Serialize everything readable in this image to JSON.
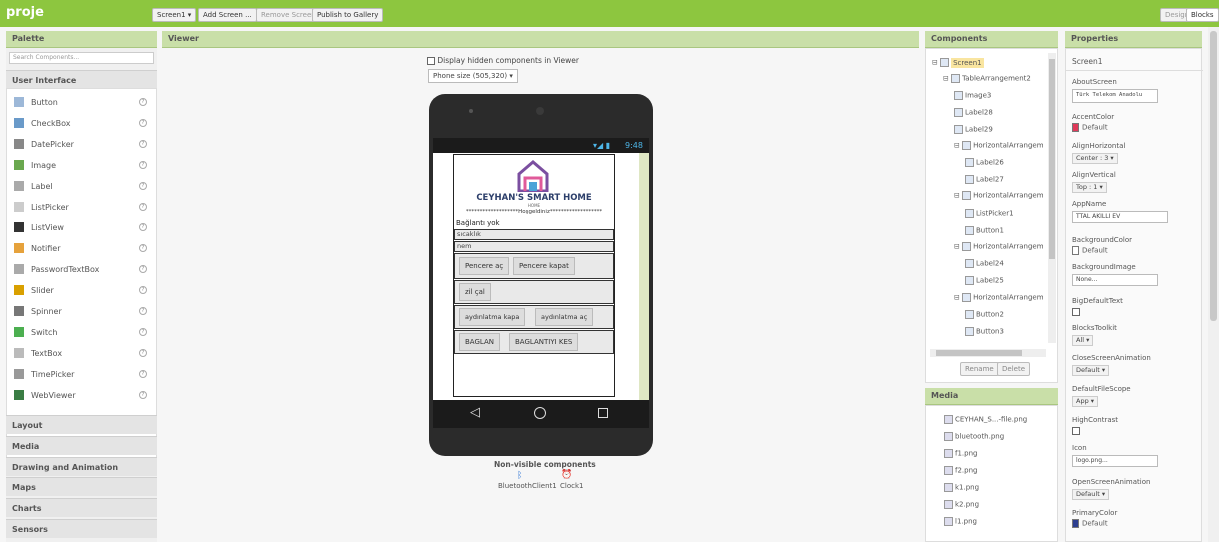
{
  "topbar": {
    "project": "proje",
    "screen_select": "Screen1 ▾",
    "add_screen": "Add Screen ...",
    "remove_screen": "Remove Screen",
    "publish": "Publish to Gallery",
    "designer": "Designer",
    "blocks": "Blocks"
  },
  "palette": {
    "title": "Palette",
    "search_placeholder": "Search Components...",
    "category_open": "User Interface",
    "items": [
      "Button",
      "CheckBox",
      "DatePicker",
      "Image",
      "Label",
      "ListPicker",
      "ListView",
      "Notifier",
      "PasswordTextBox",
      "Slider",
      "Spinner",
      "Switch",
      "TextBox",
      "TimePicker",
      "WebViewer"
    ],
    "categories": [
      "Layout",
      "Media",
      "Drawing and Animation",
      "Maps",
      "Charts",
      "Sensors"
    ],
    "help": "?"
  },
  "viewer": {
    "title": "Viewer",
    "hidden_label": "Display hidden components in Viewer",
    "phone_size": "Phone size (505,320)",
    "time": "9:48",
    "logo_title": "CEYHAN'S SMART HOME",
    "logo_sub": "HOME",
    "welcome": "*******************Hoşgeldiniz*******************",
    "status": "Bağlantı yok",
    "temp": "sıcaklık",
    "humidity": "nem",
    "btn_window_open": "Pencere aç",
    "btn_window_close": "Pencere kapat",
    "btn_bell": "zil çal",
    "btn_light_off": "aydınlatma kapa",
    "btn_light_on": "aydınlatma aç",
    "btn_connect": "BAGLAN",
    "btn_disconnect": "BAGLANTIYI KES",
    "nonvisible_title": "Non-visible components",
    "nonvisible": [
      "BluetoothClient1",
      "Clock1"
    ]
  },
  "components": {
    "title": "Components",
    "tree": [
      "Screen1",
      "TableArrangement2",
      "Image3",
      "Label28",
      "Label29",
      "HorizontalArrangem",
      "Label26",
      "Label27",
      "HorizontalArrangem",
      "ListPicker1",
      "Button1",
      "HorizontalArrangem",
      "Label24",
      "Label25",
      "HorizontalArrangem",
      "Button2",
      "Button3"
    ],
    "rename": "Rename",
    "delete": "Delete"
  },
  "media": {
    "title": "Media",
    "files": [
      "CEYHAN_S...-file.png",
      "bluetooth.png",
      "f1.png",
      "f2.png",
      "k1.png",
      "k2.png",
      "l1.png"
    ]
  },
  "properties": {
    "title": "Properties",
    "component": "Screen1",
    "about_label": "AboutScreen",
    "about_value": "Türk Telekom Anadolu",
    "accent_label": "AccentColor",
    "accent_value": "Default",
    "accent_color": "#e03a5a",
    "alignh_label": "AlignHorizontal",
    "alignh_value": "Center : 3 ▾",
    "alignv_label": "AlignVertical",
    "alignv_value": "Top : 1 ▾",
    "appname_label": "AppName",
    "appname_value": "TTAL AKILLI EV",
    "bgcolor_label": "BackgroundColor",
    "bgcolor_value": "Default",
    "bgimage_label": "BackgroundImage",
    "bgimage_value": "None...",
    "bigtext_label": "BigDefaultText",
    "toolkit_label": "BlocksToolkit",
    "toolkit_value": "All ▾",
    "closeanim_label": "CloseScreenAnimation",
    "closeanim_value": "Default ▾",
    "filescope_label": "DefaultFileScope",
    "filescope_value": "App ▾",
    "contrast_label": "HighContrast",
    "icon_label": "Icon",
    "icon_value": "logo.png...",
    "openanim_label": "OpenScreenAnimation",
    "openanim_value": "Default ▾",
    "primary_label": "PrimaryColor",
    "primary_value": "Default",
    "primary_color": "#2c3e8f"
  }
}
